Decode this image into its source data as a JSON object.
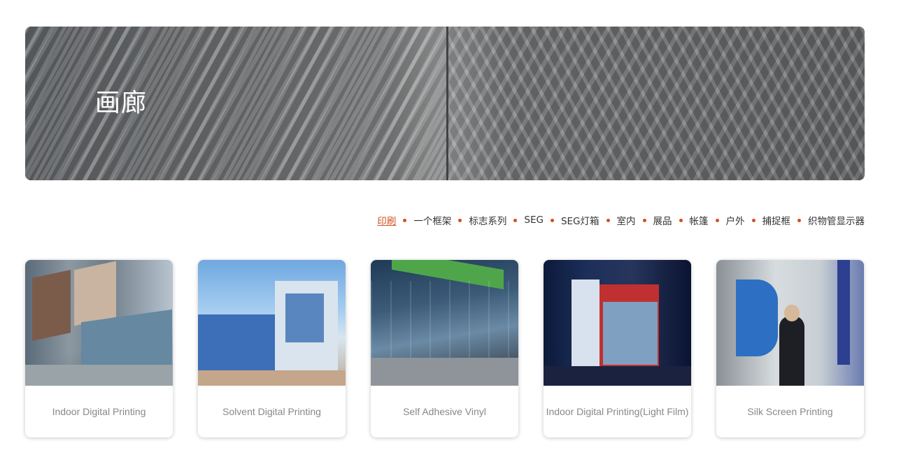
{
  "hero": {
    "title": "画廊"
  },
  "categories": [
    {
      "label": "印刷",
      "active": true
    },
    {
      "label": "一个框架",
      "active": false
    },
    {
      "label": "标志系列",
      "active": false
    },
    {
      "label": "SEG",
      "active": false
    },
    {
      "label": "SEG灯箱",
      "active": false
    },
    {
      "label": "室内",
      "active": false
    },
    {
      "label": "展品",
      "active": false
    },
    {
      "label": "帐篷",
      "active": false
    },
    {
      "label": "户外",
      "active": false
    },
    {
      "label": "捕捉框",
      "active": false
    },
    {
      "label": "织物管显示器",
      "active": false
    }
  ],
  "gallery": {
    "cards": [
      {
        "caption": "Indoor Digital Printing"
      },
      {
        "caption": "Solvent Digital Printing"
      },
      {
        "caption": "Self Adhesive Vinyl"
      },
      {
        "caption": "Indoor Digital Printing(Light Film)"
      },
      {
        "caption": "Silk Screen Printing"
      }
    ]
  },
  "colors": {
    "accent": "#d2501c",
    "caption_text": "#888888",
    "nav_text": "#333333"
  }
}
